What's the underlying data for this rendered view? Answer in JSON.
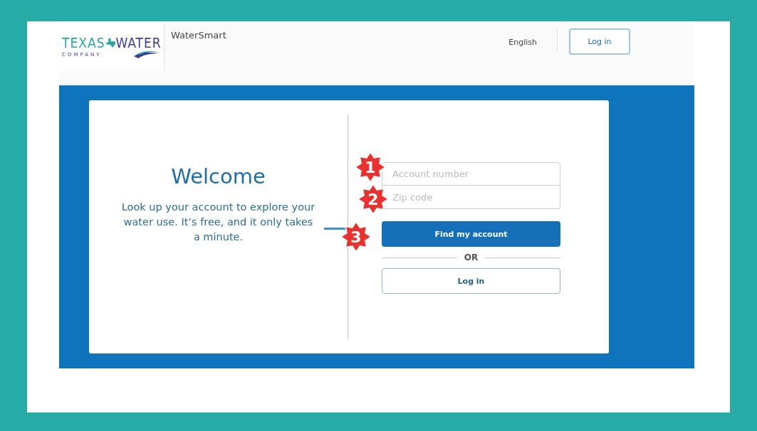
{
  "header": {
    "logo": {
      "word_1": "TEXAS",
      "word_2": "WATER",
      "subtitle": "COMPANY"
    },
    "app_name": "WaterSmart",
    "language": "English",
    "login_button": "Log in"
  },
  "welcome": {
    "title": "Welcome",
    "text": "Look up your account to explore your water use. It’s free, and it only takes a minute."
  },
  "form": {
    "fields": [
      {
        "placeholder": "Account number"
      },
      {
        "placeholder": "Zip code"
      }
    ],
    "submit_button": "Find my account",
    "divider": "OR",
    "login_button": "Log in"
  },
  "annotations": [
    {
      "label": "1"
    },
    {
      "label": "2"
    },
    {
      "label": "3"
    }
  ]
}
